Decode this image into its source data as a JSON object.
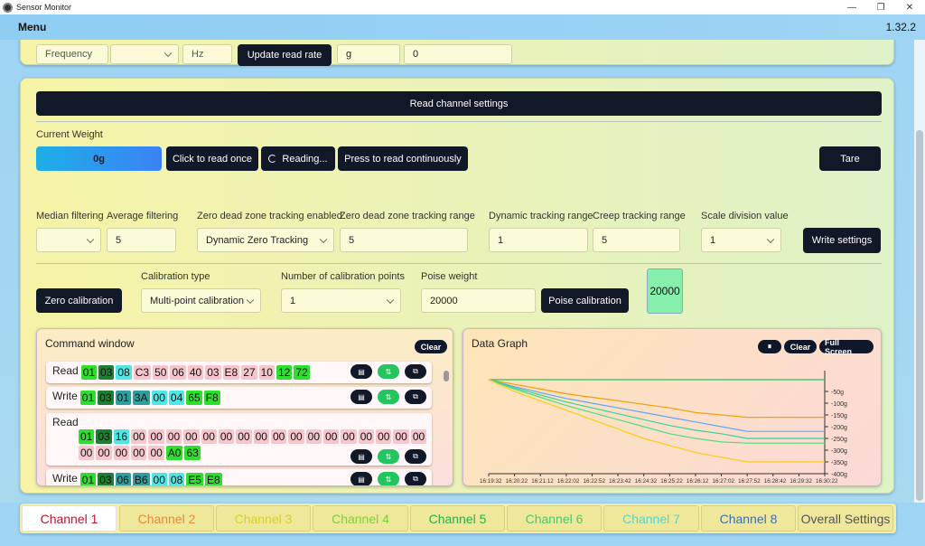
{
  "window": {
    "title": "Sensor Monitor",
    "minimize": "—",
    "restore": "❐",
    "close": "✕"
  },
  "menubar": {
    "menu_label": "Menu",
    "version": "1.32.2"
  },
  "top_row": {
    "frequency_value": "Frequency",
    "hz_value": "Hz",
    "update_button": "Update read rate",
    "unit_value": "g",
    "unit_extra": "0"
  },
  "read_settings_button": "Read channel settings",
  "current_weight": {
    "label": "Current Weight",
    "value": "0g"
  },
  "buttons": {
    "read_once": "Click to read once",
    "reading": "Reading...",
    "read_continuous": "Press to read continuously",
    "tare": "Tare",
    "write_settings": "Write settings",
    "zero_calibration": "Zero calibration",
    "poise_calibration": "Poise calibration"
  },
  "settings": {
    "median_filtering": {
      "label": "Median filtering",
      "value": ""
    },
    "average_filtering": {
      "label": "Average filtering",
      "value": "5"
    },
    "zero_tracking_enabled": {
      "label": "Zero dead zone tracking enabled",
      "value": "Dynamic Zero Tracking"
    },
    "zero_tracking_range": {
      "label": "Zero dead zone tracking range",
      "value": "5"
    },
    "dynamic_tracking_range": {
      "label": "Dynamic tracking range",
      "value": "1"
    },
    "creep_tracking_range": {
      "label": "Creep tracking range",
      "value": "5"
    },
    "scale_division": {
      "label": "Scale division value",
      "value": "1"
    }
  },
  "calibration": {
    "type": {
      "label": "Calibration type",
      "value": "Multi-point calibration"
    },
    "points": {
      "label": "Number of calibration points",
      "value": "1"
    },
    "poise_weight": {
      "label": "Poise weight",
      "value": "20000"
    },
    "result": "20000"
  },
  "command_window": {
    "title": "Command window",
    "clear": "Clear",
    "rows": [
      {
        "kind": "Read",
        "bytes": [
          {
            "v": "01",
            "c": "lgreen"
          },
          {
            "v": "03",
            "c": "dgreen"
          },
          {
            "v": "08",
            "c": "cyan"
          },
          {
            "v": "C3",
            "c": "red"
          },
          {
            "v": "50",
            "c": "red"
          },
          {
            "v": "06",
            "c": "red"
          },
          {
            "v": "40",
            "c": "red"
          },
          {
            "v": "03",
            "c": "red"
          },
          {
            "v": "E8",
            "c": "red"
          },
          {
            "v": "27",
            "c": "red"
          },
          {
            "v": "10",
            "c": "red"
          },
          {
            "v": "12",
            "c": "lgreen"
          },
          {
            "v": "72",
            "c": "lgreen"
          }
        ]
      },
      {
        "kind": "Write",
        "bytes": [
          {
            "v": "01",
            "c": "lgreen"
          },
          {
            "v": "03",
            "c": "dgreen"
          },
          {
            "v": "01",
            "c": "teal"
          },
          {
            "v": "3A",
            "c": "teal"
          },
          {
            "v": "00",
            "c": "cyan"
          },
          {
            "v": "04",
            "c": "cyan"
          },
          {
            "v": "65",
            "c": "lgreen"
          },
          {
            "v": "F8",
            "c": "lgreen"
          }
        ]
      },
      {
        "kind": "Read",
        "bytes": [
          {
            "v": "01",
            "c": "lgreen"
          },
          {
            "v": "03",
            "c": "dgreen"
          },
          {
            "v": "16",
            "c": "cyan"
          },
          {
            "v": "00",
            "c": "red"
          },
          {
            "v": "00",
            "c": "red"
          },
          {
            "v": "00",
            "c": "red"
          },
          {
            "v": "00",
            "c": "red"
          },
          {
            "v": "00",
            "c": "red"
          },
          {
            "v": "00",
            "c": "red"
          },
          {
            "v": "00",
            "c": "red"
          },
          {
            "v": "00",
            "c": "red"
          },
          {
            "v": "00",
            "c": "red"
          },
          {
            "v": "00",
            "c": "red"
          },
          {
            "v": "00",
            "c": "red"
          },
          {
            "v": "00",
            "c": "red"
          },
          {
            "v": "00",
            "c": "red"
          },
          {
            "v": "00",
            "c": "red"
          },
          {
            "v": "00",
            "c": "red"
          },
          {
            "v": "00",
            "c": "red"
          },
          {
            "v": "00",
            "c": "red"
          },
          {
            "v": "00",
            "c": "red"
          },
          {
            "v": "00",
            "c": "red"
          },
          {
            "v": "00",
            "c": "red"
          },
          {
            "v": "00",
            "c": "red"
          },
          {
            "v": "00",
            "c": "red"
          },
          {
            "v": "A0",
            "c": "lgreen"
          },
          {
            "v": "63",
            "c": "lgreen"
          }
        ]
      },
      {
        "kind": "Write",
        "bytes": [
          {
            "v": "01",
            "c": "lgreen"
          },
          {
            "v": "03",
            "c": "dgreen"
          },
          {
            "v": "06",
            "c": "teal"
          },
          {
            "v": "B6",
            "c": "teal"
          },
          {
            "v": "00",
            "c": "cyan"
          },
          {
            "v": "08",
            "c": "cyan"
          },
          {
            "v": "E5",
            "c": "lgreen"
          },
          {
            "v": "E8",
            "c": "lgreen"
          }
        ]
      }
    ]
  },
  "data_graph": {
    "title": "Data Graph",
    "pause": "⏸",
    "clear": "Clear",
    "fullscreen": "Full Screen"
  },
  "chart_data": {
    "type": "line",
    "x": [
      "16:19:32",
      "16:20:22",
      "16:21:12",
      "16:22:02",
      "16:22:52",
      "16:23:42",
      "16:24:32",
      "16:25:22",
      "16:26:12",
      "16:27:02",
      "16:27:52",
      "16:28:42",
      "16:29:32",
      "16:30:22"
    ],
    "yticks": [
      "-50g",
      "-100g",
      "-150g",
      "-200g",
      "-250g",
      "-300g",
      "-350g",
      "-400g"
    ],
    "ylim": [
      -400,
      0
    ],
    "series": [
      {
        "color": "#22c55e",
        "values": [
          0,
          0,
          0,
          0,
          0,
          0,
          0,
          0,
          0,
          0,
          0,
          0,
          0,
          0
        ]
      },
      {
        "color": "#f59e0b",
        "values": [
          0,
          -20,
          -40,
          -60,
          -75,
          -90,
          -105,
          -120,
          -140,
          -150,
          -160,
          -160,
          -160,
          -160
        ]
      },
      {
        "color": "#60a5fa",
        "values": [
          0,
          -30,
          -55,
          -80,
          -100,
          -120,
          -140,
          -160,
          -180,
          -200,
          -220,
          -220,
          -220,
          -220
        ]
      },
      {
        "color": "#34d399",
        "values": [
          0,
          -35,
          -65,
          -95,
          -120,
          -145,
          -170,
          -195,
          -215,
          -230,
          -250,
          -250,
          -250,
          -250
        ]
      },
      {
        "color": "#4ade80",
        "values": [
          0,
          -40,
          -75,
          -110,
          -140,
          -170,
          -200,
          -230,
          -250,
          -265,
          -270,
          -270,
          -270,
          -270
        ]
      },
      {
        "color": "#facc15",
        "values": [
          0,
          -50,
          -90,
          -130,
          -170,
          -210,
          -250,
          -280,
          -310,
          -330,
          -350,
          -350,
          -350,
          -350
        ]
      }
    ]
  },
  "tabs": [
    {
      "label": "Channel 1",
      "color": "#c0152f",
      "active": true
    },
    {
      "label": "Channel 2",
      "color": "#e38a3c",
      "active": false
    },
    {
      "label": "Channel 3",
      "color": "#d9d12a",
      "active": false
    },
    {
      "label": "Channel 4",
      "color": "#7fcf3a",
      "active": false
    },
    {
      "label": "Channel 5",
      "color": "#21b24a",
      "active": false
    },
    {
      "label": "Channel 6",
      "color": "#4ac96a",
      "active": false
    },
    {
      "label": "Channel 7",
      "color": "#5fd0c6",
      "active": false
    },
    {
      "label": "Channel 8",
      "color": "#3a6fb3",
      "active": false
    },
    {
      "label": "Overall Settings",
      "color": "#555555",
      "active": false
    }
  ]
}
